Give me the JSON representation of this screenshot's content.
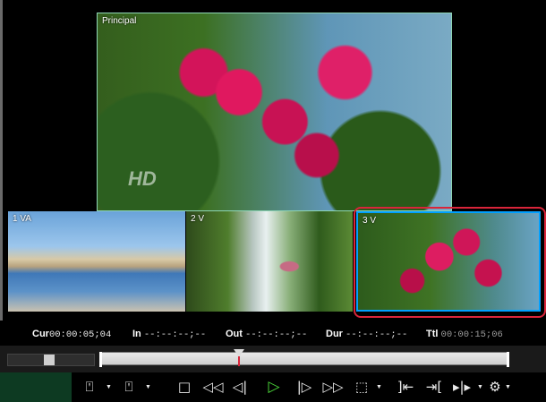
{
  "viewer": {
    "main_label": "Principal",
    "main_watermark": "HD",
    "sub_labels": [
      "1 VA",
      "2 V",
      "3 V"
    ]
  },
  "timecodes": {
    "cur_label": "Cur",
    "cur_value": "00:00:05;04",
    "in_label": "In",
    "in_value": "--:--:--;--",
    "out_label": "Out",
    "out_value": "--:--:--;--",
    "dur_label": "Dur",
    "dur_value": "--:--:--;--",
    "ttl_label": "Ttl",
    "ttl_value": "00:00:15;06"
  },
  "timeline": {
    "position_fraction": 0.34
  },
  "icons": {
    "set_in": "⍞",
    "set_out": "⍞",
    "stop": "□",
    "rewind": "◁◁",
    "step_back": "◁|",
    "play": "▷",
    "step_forward": "|▷",
    "fast_forward": "▷▷",
    "loop": "⬚",
    "go_in": "]⇤",
    "go_out": "⇥[",
    "play_in_out": "▸|▸",
    "more": "⚙"
  },
  "colors": {
    "highlight": "#d9253a",
    "selected_border": "#00a0ff",
    "main_border": "#8fd6b6",
    "play": "#4bd63a"
  }
}
